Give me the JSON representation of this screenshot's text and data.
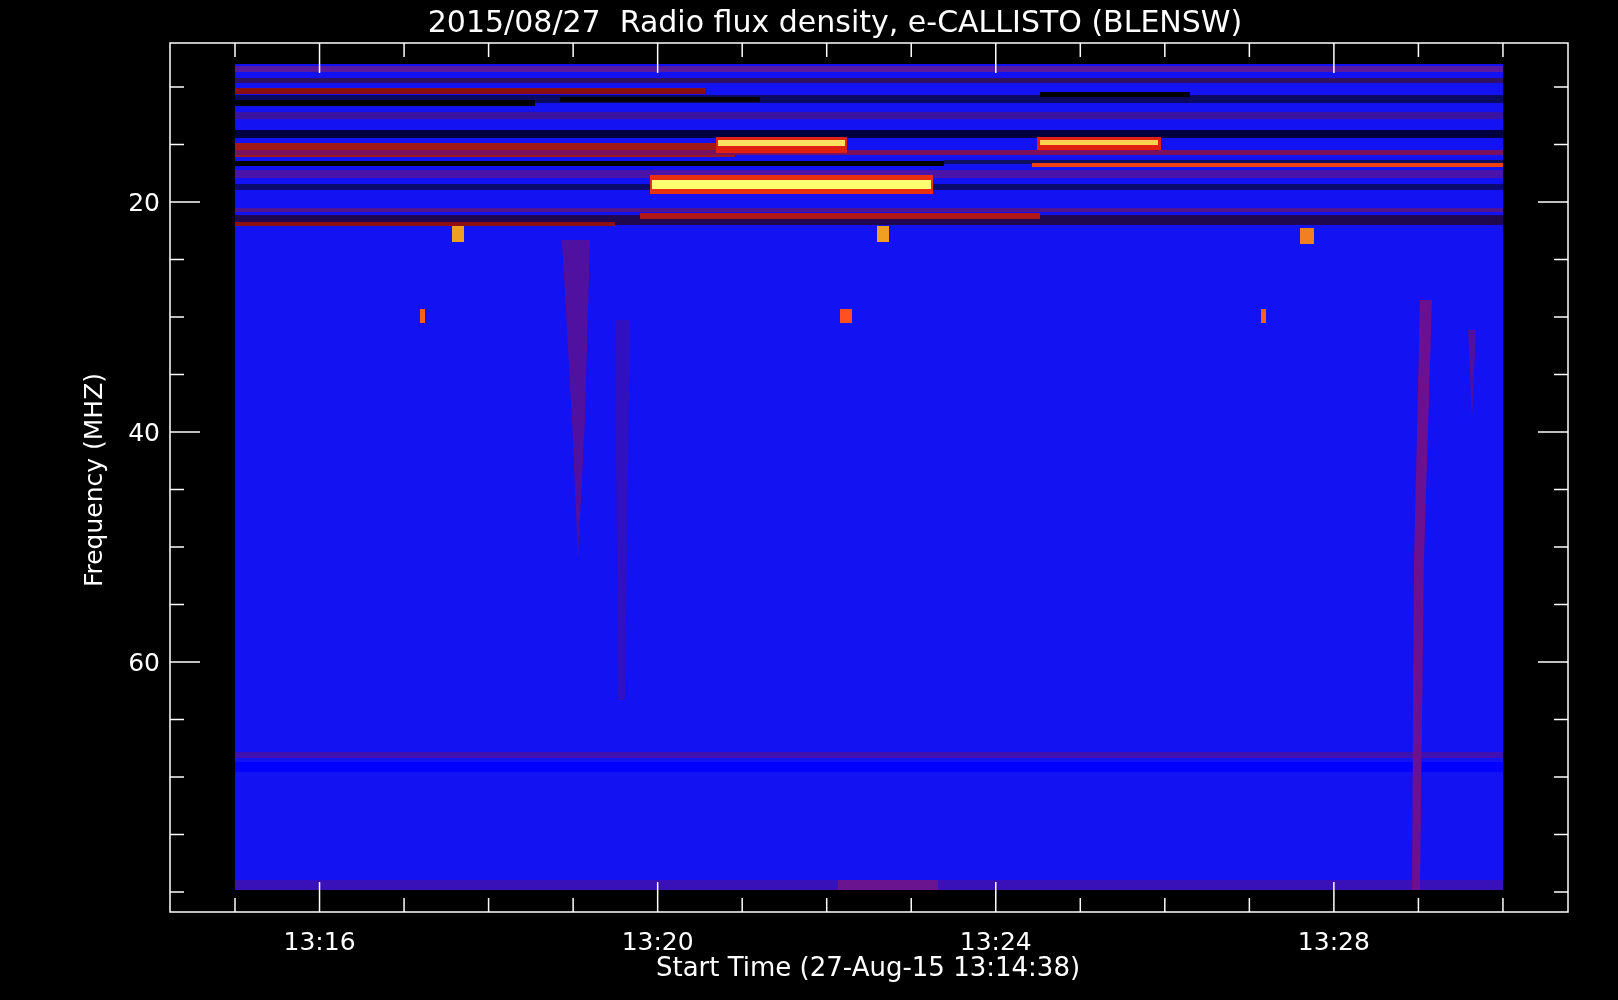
{
  "plot": {
    "title": "2015/08/27  Radio flux density, e-CALLISTO (BLENSW)",
    "ylabel": "Frequency (MHZ)",
    "xlabel": "Start Time (27-Aug-15 13:14:38)",
    "yticks": [
      "20",
      "40",
      "60"
    ],
    "xticks": [
      "13:16",
      "13:20",
      "13:24",
      "13:28"
    ]
  }
}
